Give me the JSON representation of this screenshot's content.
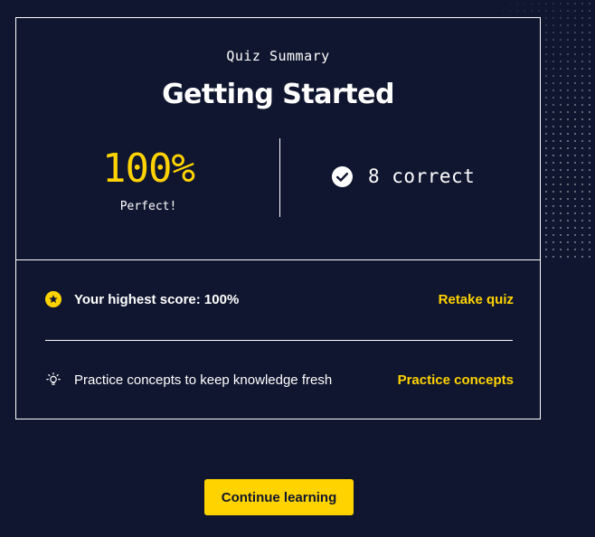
{
  "colors": {
    "background": "#10162f",
    "accent": "#ffd300",
    "text": "#ffffff"
  },
  "summary": {
    "subtitle": "Quiz Summary",
    "title": "Getting Started",
    "score": "100%",
    "score_label": "Perfect!",
    "correct_text": "8 correct",
    "correct_icon": "check-circle-icon"
  },
  "rows": [
    {
      "icon": "star-badge-icon",
      "text": "Your highest score: 100%",
      "link": "Retake quiz"
    },
    {
      "icon": "lightbulb-icon",
      "text": "Practice concepts to keep knowledge fresh",
      "link": "Practice concepts"
    }
  ],
  "footer": {
    "continue_label": "Continue learning"
  }
}
